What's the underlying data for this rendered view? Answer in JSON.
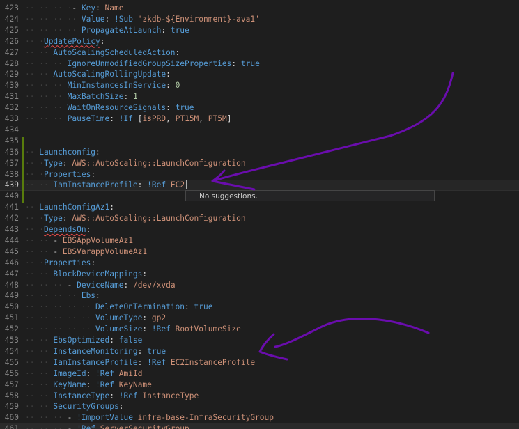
{
  "editor": {
    "suggest_widget_text": "No suggestions.",
    "lines": [
      {
        "num": "423",
        "tokens": [
          [
            "dot",
            "·· ·· ·· ·"
          ],
          [
            "dash",
            "- "
          ],
          [
            "k",
            "Key"
          ],
          [
            "p",
            ": "
          ],
          [
            "v",
            "Name"
          ]
        ]
      },
      {
        "num": "424",
        "tokens": [
          [
            "dot",
            "·· ·· ·· ·· "
          ],
          [
            "k",
            "Value"
          ],
          [
            "p",
            ": "
          ],
          [
            "t",
            "!Sub "
          ],
          [
            "v",
            "'zkdb-${Environment}-ava1'"
          ]
        ]
      },
      {
        "num": "425",
        "tokens": [
          [
            "dot",
            "·· ·· ·· ·· "
          ],
          [
            "k",
            "PropagateAtLaunch"
          ],
          [
            "p",
            ": "
          ],
          [
            "b",
            "true"
          ]
        ]
      },
      {
        "num": "426",
        "tokens": [
          [
            "dot",
            "·· ·"
          ],
          [
            "k",
            "UpdatePolicy",
            "squig"
          ],
          [
            "p",
            ":"
          ]
        ]
      },
      {
        "num": "427",
        "tokens": [
          [
            "dot",
            "·· ·· "
          ],
          [
            "k",
            "AutoScalingScheduledAction"
          ],
          [
            "p",
            ":"
          ]
        ]
      },
      {
        "num": "428",
        "tokens": [
          [
            "dot",
            "·· ·· ·· "
          ],
          [
            "k",
            "IgnoreUnmodifiedGroupSizeProperties"
          ],
          [
            "p",
            ": "
          ],
          [
            "b",
            "true"
          ]
        ]
      },
      {
        "num": "429",
        "tokens": [
          [
            "dot",
            "·· ·· "
          ],
          [
            "k",
            "AutoScalingRollingUpdate"
          ],
          [
            "p",
            ":"
          ]
        ]
      },
      {
        "num": "430",
        "tokens": [
          [
            "dot",
            "·· ·· ·· "
          ],
          [
            "k",
            "MinInstancesInService"
          ],
          [
            "p",
            ": "
          ],
          [
            "n",
            "0"
          ]
        ]
      },
      {
        "num": "431",
        "tokens": [
          [
            "dot",
            "·· ·· ·· "
          ],
          [
            "k",
            "MaxBatchSize"
          ],
          [
            "p",
            ": "
          ],
          [
            "n",
            "1"
          ]
        ]
      },
      {
        "num": "432",
        "tokens": [
          [
            "dot",
            "·· ·· ·· "
          ],
          [
            "k",
            "WaitOnResourceSignals"
          ],
          [
            "p",
            ": "
          ],
          [
            "b",
            "true"
          ]
        ]
      },
      {
        "num": "433",
        "tokens": [
          [
            "dot",
            "·· ·· ·· "
          ],
          [
            "k",
            "PauseTime"
          ],
          [
            "p",
            ": "
          ],
          [
            "t",
            "!If "
          ],
          [
            "p",
            "["
          ],
          [
            "v",
            "isPRD"
          ],
          [
            "p",
            ", "
          ],
          [
            "v",
            "PT15M"
          ],
          [
            "p",
            ", "
          ],
          [
            "v",
            "PT5M"
          ],
          [
            "p",
            "]"
          ]
        ]
      },
      {
        "num": "434",
        "tokens": []
      },
      {
        "num": "435",
        "tokens": []
      },
      {
        "num": "436",
        "tokens": [
          [
            "dot",
            "·· "
          ],
          [
            "k",
            "Launchconfig"
          ],
          [
            "p",
            ":"
          ]
        ]
      },
      {
        "num": "437",
        "tokens": [
          [
            "dot",
            "·· ·"
          ],
          [
            "k",
            "Type"
          ],
          [
            "p",
            ": "
          ],
          [
            "v",
            "AWS::AutoScaling::LaunchConfiguration"
          ]
        ]
      },
      {
        "num": "438",
        "tokens": [
          [
            "dot",
            "·· ·"
          ],
          [
            "k",
            "Properties"
          ],
          [
            "p",
            ":"
          ]
        ]
      },
      {
        "num": "439",
        "tokens": [
          [
            "dot",
            "·· ·· "
          ],
          [
            "k",
            "IamInstanceProfile"
          ],
          [
            "p",
            ": "
          ],
          [
            "t",
            "!Ref "
          ],
          [
            "v",
            "EC2"
          ]
        ]
      },
      {
        "num": "440",
        "tokens": []
      },
      {
        "num": "441",
        "tokens": [
          [
            "dot",
            "·· "
          ],
          [
            "k",
            "LaunchConfigAz1"
          ],
          [
            "p",
            ":"
          ]
        ]
      },
      {
        "num": "442",
        "tokens": [
          [
            "dot",
            "·· ·"
          ],
          [
            "k",
            "Type"
          ],
          [
            "p",
            ": "
          ],
          [
            "v",
            "AWS::AutoScaling::LaunchConfiguration"
          ]
        ]
      },
      {
        "num": "443",
        "tokens": [
          [
            "dot",
            "·· ·"
          ],
          [
            "k",
            "DependsOn",
            "squig"
          ],
          [
            "p",
            ":"
          ]
        ]
      },
      {
        "num": "444",
        "tokens": [
          [
            "dot",
            "·· ·· "
          ],
          [
            "dash",
            "- "
          ],
          [
            "v",
            "EBSAppVolumeAz1"
          ]
        ]
      },
      {
        "num": "445",
        "tokens": [
          [
            "dot",
            "·· ·· "
          ],
          [
            "dash",
            "- "
          ],
          [
            "v",
            "EBSVarappVolumeAz1"
          ]
        ]
      },
      {
        "num": "446",
        "tokens": [
          [
            "dot",
            "·· ·"
          ],
          [
            "k",
            "Properties"
          ],
          [
            "p",
            ":"
          ]
        ]
      },
      {
        "num": "447",
        "tokens": [
          [
            "dot",
            "·· ·· "
          ],
          [
            "k",
            "BlockDeviceMappings"
          ],
          [
            "p",
            ":"
          ]
        ]
      },
      {
        "num": "448",
        "tokens": [
          [
            "dot",
            "·· ·· ·· "
          ],
          [
            "dash",
            "- "
          ],
          [
            "k",
            "DeviceName"
          ],
          [
            "p",
            ": "
          ],
          [
            "v",
            "/dev/xvda"
          ]
        ]
      },
      {
        "num": "449",
        "tokens": [
          [
            "dot",
            "·· ·· ·· ·· "
          ],
          [
            "k",
            "Ebs"
          ],
          [
            "p",
            ":"
          ]
        ]
      },
      {
        "num": "450",
        "tokens": [
          [
            "dot",
            "·· ·· ·· ·· ·· "
          ],
          [
            "k",
            "DeleteOnTermination"
          ],
          [
            "p",
            ": "
          ],
          [
            "b",
            "true"
          ]
        ]
      },
      {
        "num": "451",
        "tokens": [
          [
            "dot",
            "·· ·· ·· ·· ·· "
          ],
          [
            "k",
            "VolumeType"
          ],
          [
            "p",
            ": "
          ],
          [
            "v",
            "gp2"
          ]
        ]
      },
      {
        "num": "452",
        "tokens": [
          [
            "dot",
            "·· ·· ·· ·· ·· "
          ],
          [
            "k",
            "VolumeSize"
          ],
          [
            "p",
            ": "
          ],
          [
            "t",
            "!Ref "
          ],
          [
            "v",
            "RootVolumeSize"
          ]
        ]
      },
      {
        "num": "453",
        "tokens": [
          [
            "dot",
            "·· ·· "
          ],
          [
            "k",
            "EbsOptimized"
          ],
          [
            "p",
            ": "
          ],
          [
            "b",
            "false"
          ]
        ]
      },
      {
        "num": "454",
        "tokens": [
          [
            "dot",
            "·· ·· "
          ],
          [
            "k",
            "InstanceMonitoring"
          ],
          [
            "p",
            ": "
          ],
          [
            "b",
            "true"
          ]
        ]
      },
      {
        "num": "455",
        "tokens": [
          [
            "dot",
            "·· ·· "
          ],
          [
            "k",
            "IamInstanceProfile"
          ],
          [
            "p",
            ": "
          ],
          [
            "t",
            "!Ref "
          ],
          [
            "v",
            "EC2InstanceProfile"
          ]
        ]
      },
      {
        "num": "456",
        "tokens": [
          [
            "dot",
            "·· ·· "
          ],
          [
            "k",
            "ImageId"
          ],
          [
            "p",
            ": "
          ],
          [
            "t",
            "!Ref "
          ],
          [
            "v",
            "AmiId"
          ]
        ]
      },
      {
        "num": "457",
        "tokens": [
          [
            "dot",
            "·· ·· "
          ],
          [
            "k",
            "KeyName"
          ],
          [
            "p",
            ": "
          ],
          [
            "t",
            "!Ref "
          ],
          [
            "v",
            "KeyName"
          ]
        ]
      },
      {
        "num": "458",
        "tokens": [
          [
            "dot",
            "·· ·· "
          ],
          [
            "k",
            "InstanceType"
          ],
          [
            "p",
            ": "
          ],
          [
            "t",
            "!Ref "
          ],
          [
            "v",
            "InstanceType"
          ]
        ]
      },
      {
        "num": "459",
        "tokens": [
          [
            "dot",
            "·· ·· "
          ],
          [
            "k",
            "SecurityGroups"
          ],
          [
            "p",
            ":"
          ]
        ]
      },
      {
        "num": "460",
        "tokens": [
          [
            "dot",
            "·· ·· ·· "
          ],
          [
            "dash",
            "- "
          ],
          [
            "t",
            "!ImportValue "
          ],
          [
            "v",
            "infra-base-InfraSecurityGroup"
          ]
        ]
      },
      {
        "num": "461",
        "tokens": [
          [
            "dot",
            "·· ·· ·· "
          ],
          [
            "dash",
            "- "
          ],
          [
            "t",
            "!Ref "
          ],
          [
            "v",
            "ServerSecurityGroup"
          ]
        ]
      }
    ]
  }
}
